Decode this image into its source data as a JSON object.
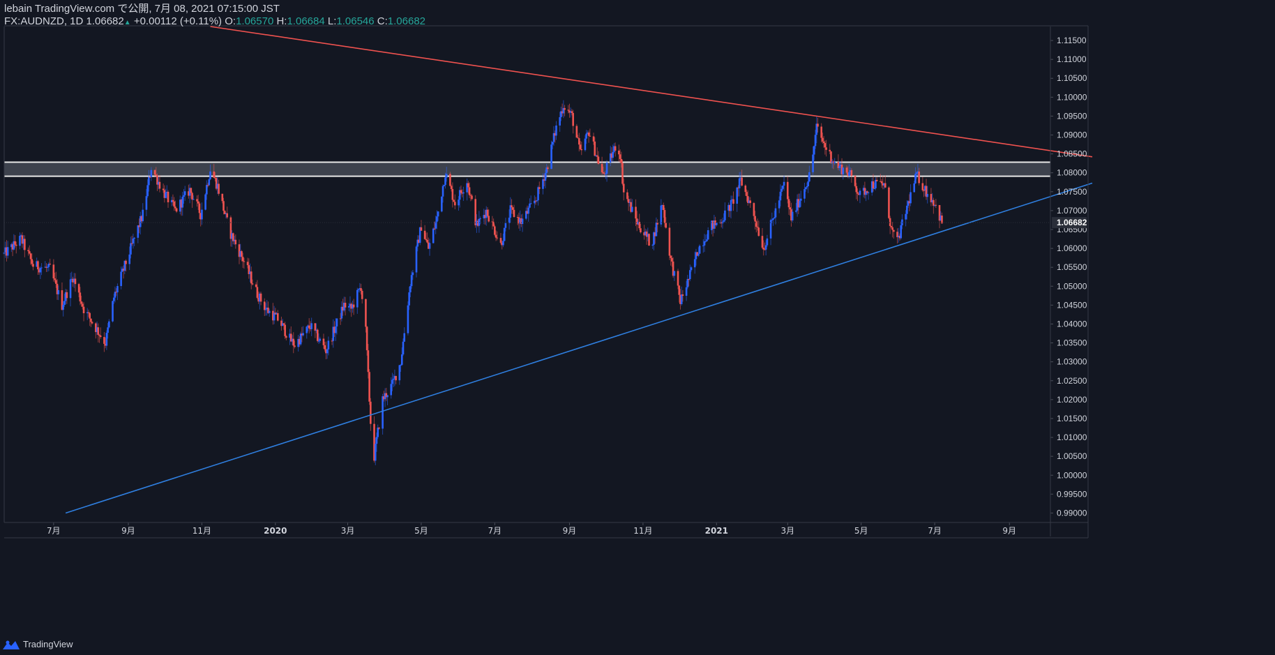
{
  "header": {
    "line1": "lebain TradingView.com で公開, 7月 08, 2021 07:15:00 JST",
    "symbol": "FX:AUDNZD, 1D",
    "last": "1.06682",
    "change": "+0.00112 (+0.11%)",
    "o_label": "O:",
    "o": "1.06570",
    "h_label": "H:",
    "h": "1.06684",
    "l_label": "L:",
    "l": "1.06546",
    "c_label": "C:",
    "c": "1.06682"
  },
  "footer": {
    "brand": "TradingView"
  },
  "colors": {
    "bg": "#131722",
    "up": "#2962ff",
    "down": "#ef5350",
    "resistance": "#f0524f",
    "support": "#2f7fe0",
    "zone_line": "#e8e8e8",
    "text": "#d1d4dc",
    "green": "#26a69a"
  },
  "chart_data": {
    "type": "candlestick",
    "symbol": "FX:AUDNZD",
    "timeframe": "1D",
    "last_price_label": "1.06682",
    "ylim": [
      0.9875,
      1.1187
    ],
    "y_ticks": [
      "0.99000",
      "0.99500",
      "1.00000",
      "1.00500",
      "1.01000",
      "1.01500",
      "1.02000",
      "1.02500",
      "1.03000",
      "1.03500",
      "1.04000",
      "1.04500",
      "1.05000",
      "1.05500",
      "1.06000",
      "1.06500",
      "1.07000",
      "1.07500",
      "1.08000",
      "1.08500",
      "1.09000",
      "1.09500",
      "1.10000",
      "1.10500",
      "1.11000",
      "1.11500"
    ],
    "x_ticks": [
      {
        "label": "7月",
        "date": "2019-07-01"
      },
      {
        "label": "9月",
        "date": "2019-09-01"
      },
      {
        "label": "11月",
        "date": "2019-11-01"
      },
      {
        "label": "2020",
        "date": "2020-01-01"
      },
      {
        "label": "3月",
        "date": "2020-03-01"
      },
      {
        "label": "5月",
        "date": "2020-05-01"
      },
      {
        "label": "7月",
        "date": "2020-07-01"
      },
      {
        "label": "9月",
        "date": "2020-09-01"
      },
      {
        "label": "11月",
        "date": "2020-11-01"
      },
      {
        "label": "2021",
        "date": "2021-01-01"
      },
      {
        "label": "3月",
        "date": "2021-03-01"
      },
      {
        "label": "5月",
        "date": "2021-05-01"
      },
      {
        "label": "7月",
        "date": "2021-07-01"
      },
      {
        "label": "9月",
        "date": "2021-09-01"
      }
    ],
    "xlim": [
      "2019-05-21",
      "2021-10-05"
    ],
    "anchors": [
      [
        "2019-05-21",
        1.0585
      ],
      [
        "2019-06-04",
        1.0625
      ],
      [
        "2019-06-14",
        1.0555
      ],
      [
        "2019-06-28",
        1.0545
      ],
      [
        "2019-07-08",
        1.045
      ],
      [
        "2019-07-17",
        1.0525
      ],
      [
        "2019-07-26",
        1.044
      ],
      [
        "2019-08-13",
        1.035
      ],
      [
        "2019-08-20",
        1.047
      ],
      [
        "2019-09-02",
        1.059
      ],
      [
        "2019-09-13",
        1.069
      ],
      [
        "2019-09-20",
        1.0815
      ],
      [
        "2019-09-30",
        1.075
      ],
      [
        "2019-10-10",
        1.07
      ],
      [
        "2019-10-22",
        1.0755
      ],
      [
        "2019-10-31",
        1.069
      ],
      [
        "2019-11-08",
        1.081
      ],
      [
        "2019-11-14",
        1.0765
      ],
      [
        "2019-11-24",
        1.0645
      ],
      [
        "2019-12-06",
        1.0565
      ],
      [
        "2019-12-17",
        1.048
      ],
      [
        "2019-12-24",
        1.044
      ],
      [
        "2020-01-04",
        1.041
      ],
      [
        "2020-01-13",
        1.036
      ],
      [
        "2020-01-17",
        1.0345
      ],
      [
        "2020-01-30",
        1.0395
      ],
      [
        "2020-02-12",
        1.033
      ],
      [
        "2020-02-27",
        1.045
      ],
      [
        "2020-03-04",
        1.044
      ],
      [
        "2020-03-12",
        1.05
      ],
      [
        "2020-03-16",
        1.038
      ],
      [
        "2020-03-20",
        1.014
      ],
      [
        "2020-03-23",
        1.005
      ],
      [
        "2020-03-30",
        1.02
      ],
      [
        "2020-04-07",
        1.024
      ],
      [
        "2020-04-14",
        1.03
      ],
      [
        "2020-04-22",
        1.051
      ],
      [
        "2020-05-01",
        1.066
      ],
      [
        "2020-05-07",
        1.06
      ],
      [
        "2020-05-14",
        1.068
      ],
      [
        "2020-05-21",
        1.08
      ],
      [
        "2020-05-29",
        1.072
      ],
      [
        "2020-06-08",
        1.078
      ],
      [
        "2020-06-16",
        1.066
      ],
      [
        "2020-06-24",
        1.07
      ],
      [
        "2020-07-06",
        1.061
      ],
      [
        "2020-07-14",
        1.07
      ],
      [
        "2020-07-23",
        1.067
      ],
      [
        "2020-08-04",
        1.073
      ],
      [
        "2020-08-13",
        1.081
      ],
      [
        "2020-08-21",
        1.092
      ],
      [
        "2020-08-27",
        1.098
      ],
      [
        "2020-09-03",
        1.095
      ],
      [
        "2020-09-10",
        1.085
      ],
      [
        "2020-09-17",
        1.091
      ],
      [
        "2020-09-29",
        1.079
      ],
      [
        "2020-10-09",
        1.087
      ],
      [
        "2020-10-13",
        1.085
      ],
      [
        "2020-10-16",
        1.075
      ],
      [
        "2020-10-27",
        1.067
      ],
      [
        "2020-11-08",
        1.061
      ],
      [
        "2020-11-17",
        1.072
      ],
      [
        "2020-11-24",
        1.057
      ],
      [
        "2020-12-02",
        1.046
      ],
      [
        "2020-12-09",
        1.052
      ],
      [
        "2020-12-17",
        1.06
      ],
      [
        "2020-12-28",
        1.066
      ],
      [
        "2021-01-04",
        1.067
      ],
      [
        "2021-01-14",
        1.072
      ],
      [
        "2021-01-21",
        1.078
      ],
      [
        "2021-01-31",
        1.07
      ],
      [
        "2021-02-09",
        1.06
      ],
      [
        "2021-02-17",
        1.068
      ],
      [
        "2021-02-26",
        1.077
      ],
      [
        "2021-03-04",
        1.068
      ],
      [
        "2021-03-11",
        1.073
      ],
      [
        "2021-03-20",
        1.08
      ],
      [
        "2021-03-25",
        1.092
      ],
      [
        "2021-04-01",
        1.087
      ],
      [
        "2021-04-10",
        1.082
      ],
      [
        "2021-04-21",
        1.08
      ],
      [
        "2021-04-30",
        1.074
      ],
      [
        "2021-05-10",
        1.077
      ],
      [
        "2021-05-20",
        1.077
      ],
      [
        "2021-05-26",
        1.065
      ],
      [
        "2021-05-31",
        1.0615
      ],
      [
        "2021-06-09",
        1.072
      ],
      [
        "2021-06-16",
        1.0795
      ],
      [
        "2021-06-24",
        1.075
      ],
      [
        "2021-07-01",
        1.072
      ],
      [
        "2021-07-07",
        1.0668
      ]
    ],
    "resistance_line": {
      "points": [
        [
          "2019-11-08",
          1.1187
        ],
        [
          "2020-08-27",
          1.1045
        ],
        [
          "2021-03-25",
          1.095
        ]
      ]
    },
    "support_line": {
      "points": [
        [
          "2019-07-11",
          0.99
        ],
        [
          "2020-03-20",
          1.0142
        ],
        [
          "2020-12-02",
          1.0422
        ],
        [
          "2021-05-31",
          1.0607
        ]
      ]
    },
    "resistance_zone": {
      "top": 1.0828,
      "bottom": 1.0791
    }
  }
}
